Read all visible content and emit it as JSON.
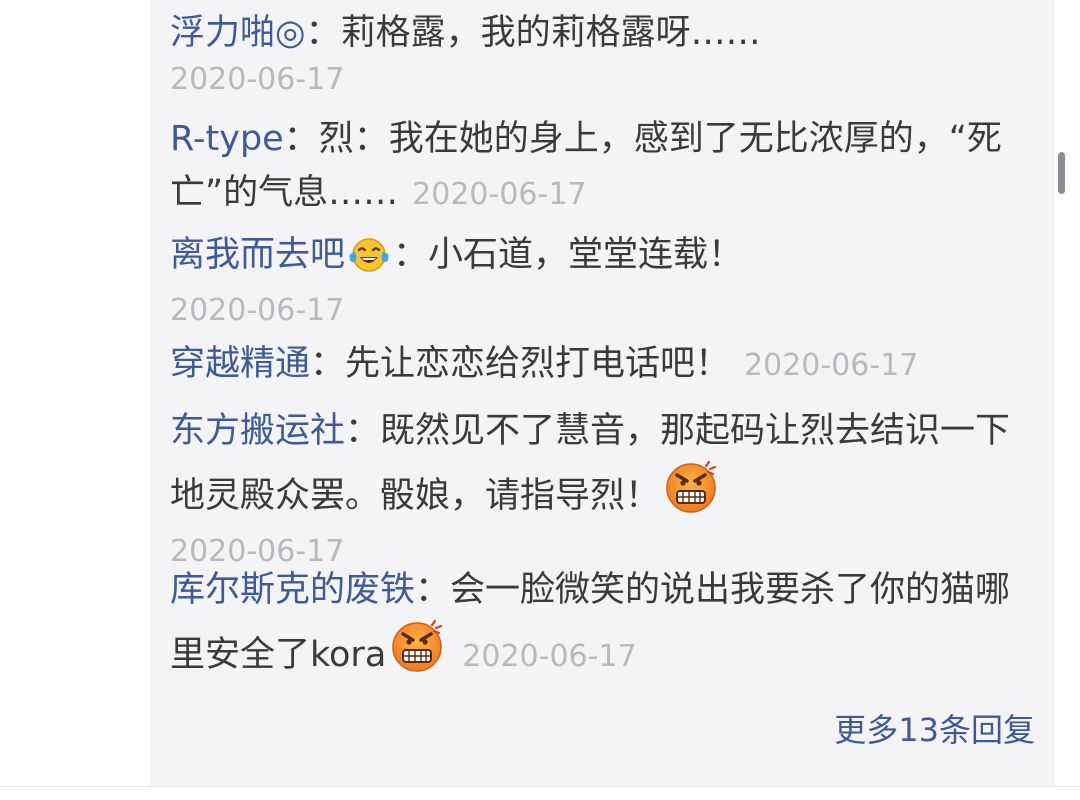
{
  "comments": [
    {
      "user": "浮力啪◎",
      "text": "莉格露，我的莉格露呀……",
      "time": "2020-06-17"
    },
    {
      "user": "R-type",
      "text": "烈：我在她的身上，感到了无比浓厚的，“死亡”的气息……",
      "time": "2020-06-17"
    },
    {
      "user": "离我而去吧",
      "user_emoji": "laughing-tears",
      "text": "小石道，堂堂连载！",
      "time": "2020-06-17"
    },
    {
      "user": "穿越精通",
      "text": "先让恋恋给烈打电话吧！",
      "time": "2020-06-17"
    },
    {
      "user": "东方搬运社",
      "text": "既然见不了慧音，那起码让烈去结识一下地灵殿众罢。骰娘，请指导烈！",
      "text_emoji": "angry-face",
      "time": "2020-06-17"
    },
    {
      "user": "库尔斯克的废铁",
      "text": "会一脸微笑的说出我要杀了你的猫哪里安全了kora",
      "text_emoji": "angry-face",
      "time": "2020-06-17"
    }
  ],
  "separator": "：",
  "more_replies": "更多13条回复",
  "colors": {
    "username": "#3e5a99",
    "text": "#3a3a3a",
    "timestamp": "#b9b9bd",
    "background": "#f4f4f6"
  }
}
